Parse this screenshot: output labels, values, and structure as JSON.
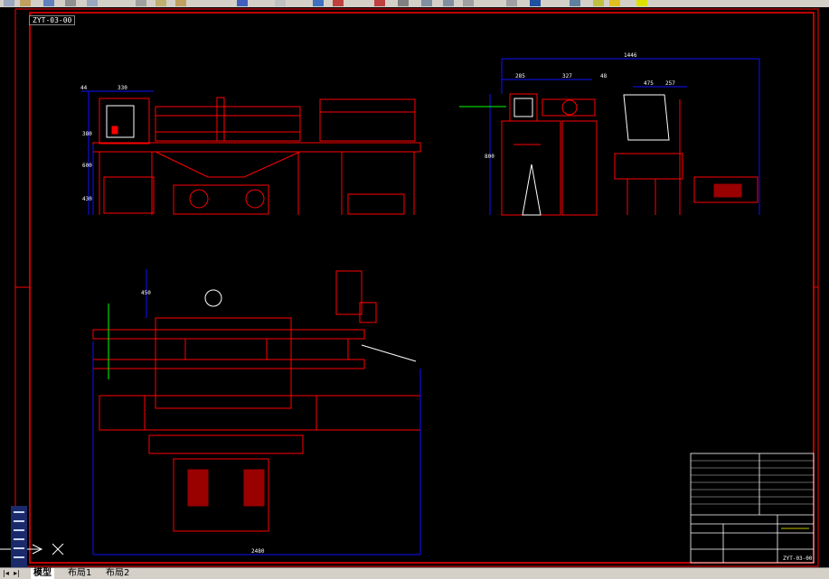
{
  "window": {
    "file_label": "ZYT-03-00"
  },
  "tabs": [
    {
      "label": "模型",
      "active": true
    },
    {
      "label": "布局1",
      "active": false
    },
    {
      "label": "布局2",
      "active": false
    }
  ],
  "drawing": {
    "dims_view1": [
      "44",
      "330",
      "380",
      "600",
      "430"
    ],
    "dims_view2": [
      "1446",
      "285",
      "327",
      "48",
      "475",
      "257",
      "800"
    ],
    "dims_view3": [
      "2480",
      "450"
    ],
    "title_block_code": "ZYT-03-00"
  },
  "colors": {
    "background": "#000000",
    "frame": "#ff0000",
    "geometry": "#ff0000",
    "dimensions": "#1010ff",
    "outline": "#ffffff",
    "centerline": "#00ff00"
  }
}
